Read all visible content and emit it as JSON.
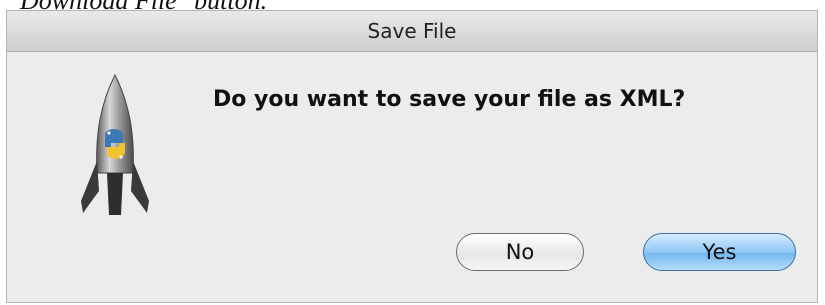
{
  "background_text": "Download File\" button.",
  "dialog": {
    "title": "Save File",
    "message": "Do you want to save your file as XML?",
    "icon": "python-rocket-icon",
    "buttons": {
      "no_label": "No",
      "yes_label": "Yes"
    },
    "colors": {
      "default_button": "#8fc7f5",
      "dialog_background": "#ececec"
    }
  }
}
